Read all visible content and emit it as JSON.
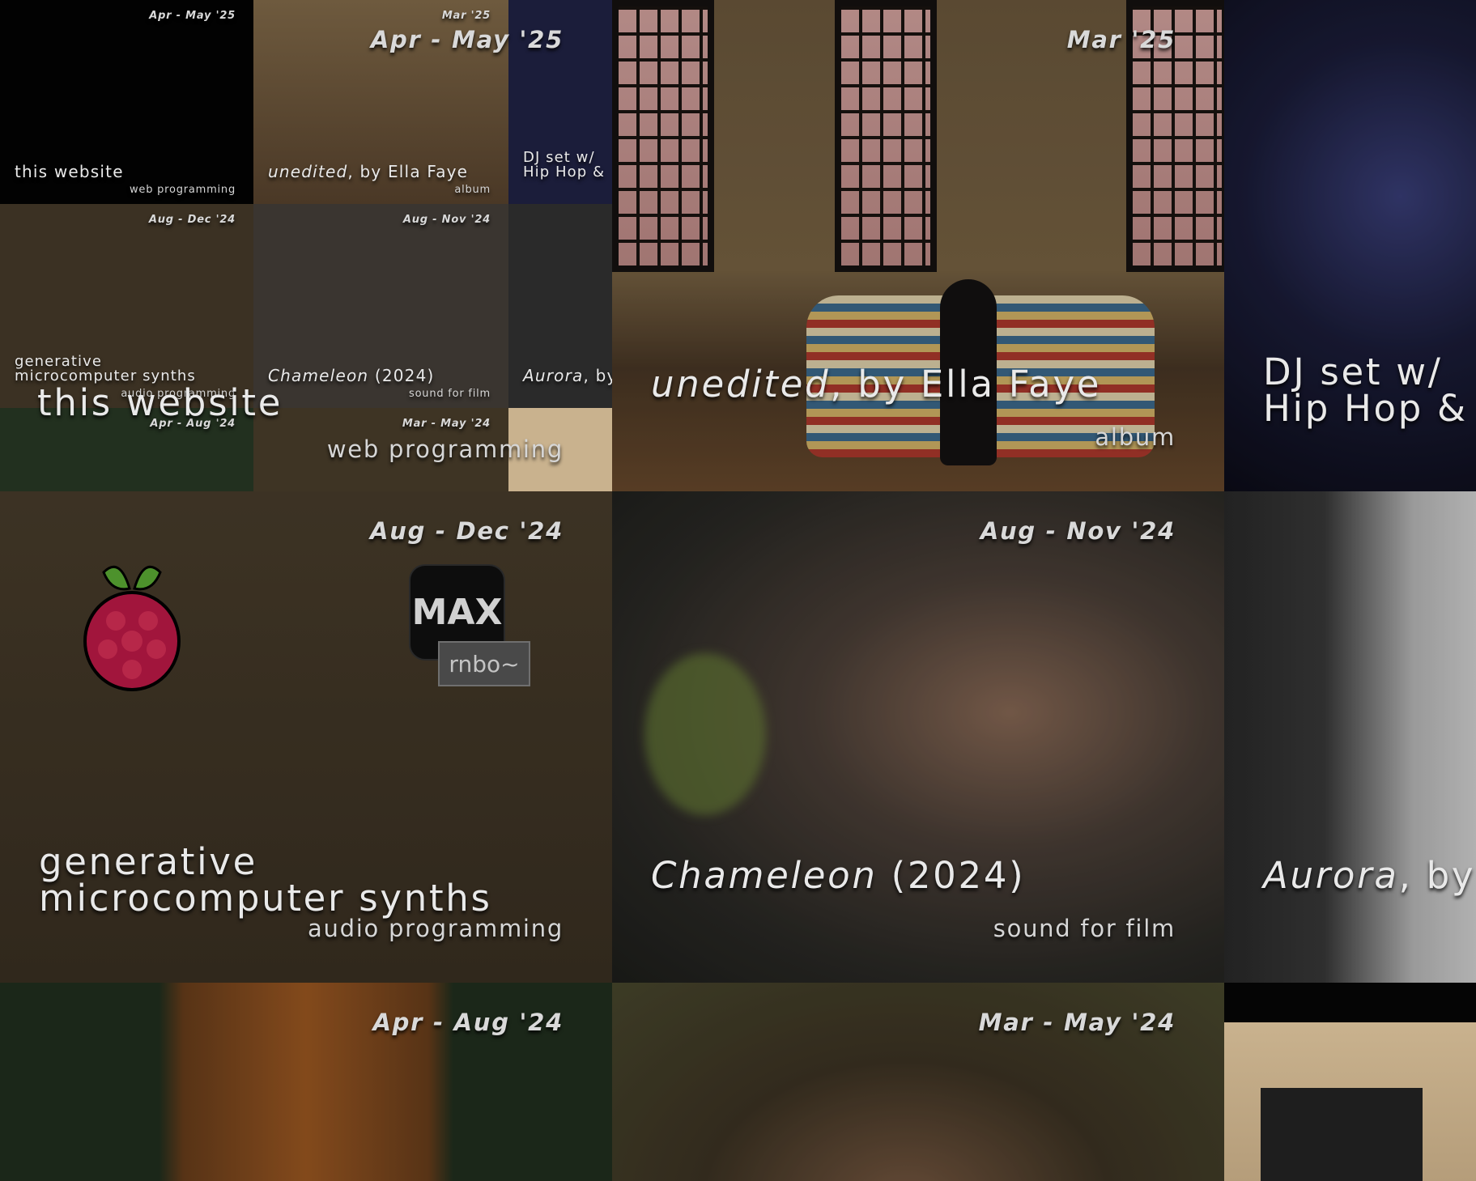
{
  "projects": [
    {
      "id": "website",
      "date": "Apr - May '25",
      "title": "this website",
      "category": "web programming"
    },
    {
      "id": "unedited",
      "date": "Mar '25",
      "title_italic": "unedited",
      "title_rest": ", by Ella Faye",
      "category": "album"
    },
    {
      "id": "djset",
      "date": "",
      "title_line1": "DJ set w/",
      "title_line2": "Hip Hop &",
      "category": ""
    },
    {
      "id": "synths",
      "date": "Aug - Dec '24",
      "title_line1": "generative",
      "title_line2": "microcomputer synths",
      "category": "audio programming"
    },
    {
      "id": "chameleon",
      "date": "Aug - Nov '24",
      "title_italic": "Chameleon",
      "title_rest": " (2024)",
      "category": "sound for film"
    },
    {
      "id": "aurora",
      "date": "",
      "title_italic": "Aurora",
      "title_rest": ", by",
      "category": ""
    },
    {
      "id": "studio",
      "date": "Apr - Aug '24",
      "title": "",
      "category": ""
    },
    {
      "id": "portrait",
      "date": "Mar - May '24",
      "title": "",
      "category": ""
    }
  ],
  "overlay": {
    "big_title": "this website",
    "big_category": "web programming",
    "big_date": "Apr - May '25"
  },
  "mini": {
    "website": {
      "date": "Apr - May '25",
      "title": "this website",
      "category": "web programming"
    },
    "unedited": {
      "date": "Mar '25",
      "title_italic": "unedited",
      "title_rest": ", by Ella Faye",
      "category": "album"
    },
    "dj": {
      "title_line1": "DJ set w/",
      "title_line2": "Hip Hop &"
    },
    "synths": {
      "date": "Aug - Dec '24",
      "title_line1": "generative",
      "title_line2": "microcomputer synths",
      "category": "audio programming"
    },
    "chameleon": {
      "date": "Aug - Nov '24",
      "title_italic": "Chameleon",
      "title_rest": " (2024)",
      "category": "sound for film"
    },
    "aurora": {
      "title_italic": "Aurora",
      "title_rest": ", by"
    },
    "studio": {
      "date": "Apr - Aug '24"
    },
    "portrait": {
      "date": "Mar - May '24"
    }
  },
  "icons": {
    "max_label": "MAX",
    "rnbo_label": "rnbo~"
  }
}
